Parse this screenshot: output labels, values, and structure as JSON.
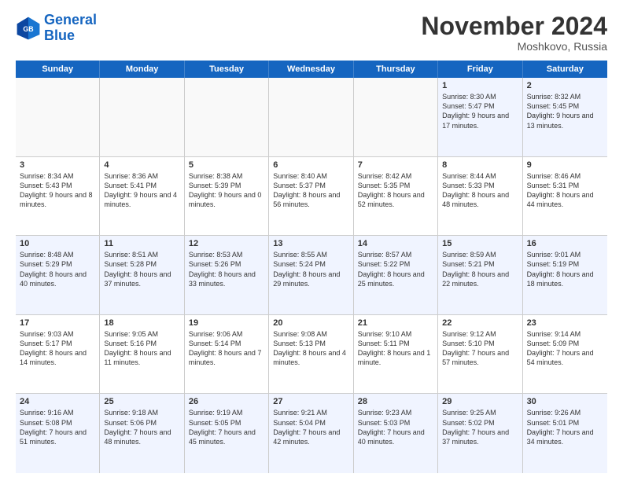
{
  "header": {
    "logo_line1": "General",
    "logo_line2": "Blue",
    "month": "November 2024",
    "location": "Moshkovo, Russia"
  },
  "days_of_week": [
    "Sunday",
    "Monday",
    "Tuesday",
    "Wednesday",
    "Thursday",
    "Friday",
    "Saturday"
  ],
  "rows": [
    [
      {
        "day": "",
        "info": ""
      },
      {
        "day": "",
        "info": ""
      },
      {
        "day": "",
        "info": ""
      },
      {
        "day": "",
        "info": ""
      },
      {
        "day": "",
        "info": ""
      },
      {
        "day": "1",
        "info": "Sunrise: 8:30 AM\nSunset: 5:47 PM\nDaylight: 9 hours and 17 minutes."
      },
      {
        "day": "2",
        "info": "Sunrise: 8:32 AM\nSunset: 5:45 PM\nDaylight: 9 hours and 13 minutes."
      }
    ],
    [
      {
        "day": "3",
        "info": "Sunrise: 8:34 AM\nSunset: 5:43 PM\nDaylight: 9 hours and 8 minutes."
      },
      {
        "day": "4",
        "info": "Sunrise: 8:36 AM\nSunset: 5:41 PM\nDaylight: 9 hours and 4 minutes."
      },
      {
        "day": "5",
        "info": "Sunrise: 8:38 AM\nSunset: 5:39 PM\nDaylight: 9 hours and 0 minutes."
      },
      {
        "day": "6",
        "info": "Sunrise: 8:40 AM\nSunset: 5:37 PM\nDaylight: 8 hours and 56 minutes."
      },
      {
        "day": "7",
        "info": "Sunrise: 8:42 AM\nSunset: 5:35 PM\nDaylight: 8 hours and 52 minutes."
      },
      {
        "day": "8",
        "info": "Sunrise: 8:44 AM\nSunset: 5:33 PM\nDaylight: 8 hours and 48 minutes."
      },
      {
        "day": "9",
        "info": "Sunrise: 8:46 AM\nSunset: 5:31 PM\nDaylight: 8 hours and 44 minutes."
      }
    ],
    [
      {
        "day": "10",
        "info": "Sunrise: 8:48 AM\nSunset: 5:29 PM\nDaylight: 8 hours and 40 minutes."
      },
      {
        "day": "11",
        "info": "Sunrise: 8:51 AM\nSunset: 5:28 PM\nDaylight: 8 hours and 37 minutes."
      },
      {
        "day": "12",
        "info": "Sunrise: 8:53 AM\nSunset: 5:26 PM\nDaylight: 8 hours and 33 minutes."
      },
      {
        "day": "13",
        "info": "Sunrise: 8:55 AM\nSunset: 5:24 PM\nDaylight: 8 hours and 29 minutes."
      },
      {
        "day": "14",
        "info": "Sunrise: 8:57 AM\nSunset: 5:22 PM\nDaylight: 8 hours and 25 minutes."
      },
      {
        "day": "15",
        "info": "Sunrise: 8:59 AM\nSunset: 5:21 PM\nDaylight: 8 hours and 22 minutes."
      },
      {
        "day": "16",
        "info": "Sunrise: 9:01 AM\nSunset: 5:19 PM\nDaylight: 8 hours and 18 minutes."
      }
    ],
    [
      {
        "day": "17",
        "info": "Sunrise: 9:03 AM\nSunset: 5:17 PM\nDaylight: 8 hours and 14 minutes."
      },
      {
        "day": "18",
        "info": "Sunrise: 9:05 AM\nSunset: 5:16 PM\nDaylight: 8 hours and 11 minutes."
      },
      {
        "day": "19",
        "info": "Sunrise: 9:06 AM\nSunset: 5:14 PM\nDaylight: 8 hours and 7 minutes."
      },
      {
        "day": "20",
        "info": "Sunrise: 9:08 AM\nSunset: 5:13 PM\nDaylight: 8 hours and 4 minutes."
      },
      {
        "day": "21",
        "info": "Sunrise: 9:10 AM\nSunset: 5:11 PM\nDaylight: 8 hours and 1 minute."
      },
      {
        "day": "22",
        "info": "Sunrise: 9:12 AM\nSunset: 5:10 PM\nDaylight: 7 hours and 57 minutes."
      },
      {
        "day": "23",
        "info": "Sunrise: 9:14 AM\nSunset: 5:09 PM\nDaylight: 7 hours and 54 minutes."
      }
    ],
    [
      {
        "day": "24",
        "info": "Sunrise: 9:16 AM\nSunset: 5:08 PM\nDaylight: 7 hours and 51 minutes."
      },
      {
        "day": "25",
        "info": "Sunrise: 9:18 AM\nSunset: 5:06 PM\nDaylight: 7 hours and 48 minutes."
      },
      {
        "day": "26",
        "info": "Sunrise: 9:19 AM\nSunset: 5:05 PM\nDaylight: 7 hours and 45 minutes."
      },
      {
        "day": "27",
        "info": "Sunrise: 9:21 AM\nSunset: 5:04 PM\nDaylight: 7 hours and 42 minutes."
      },
      {
        "day": "28",
        "info": "Sunrise: 9:23 AM\nSunset: 5:03 PM\nDaylight: 7 hours and 40 minutes."
      },
      {
        "day": "29",
        "info": "Sunrise: 9:25 AM\nSunset: 5:02 PM\nDaylight: 7 hours and 37 minutes."
      },
      {
        "day": "30",
        "info": "Sunrise: 9:26 AM\nSunset: 5:01 PM\nDaylight: 7 hours and 34 minutes."
      }
    ]
  ]
}
